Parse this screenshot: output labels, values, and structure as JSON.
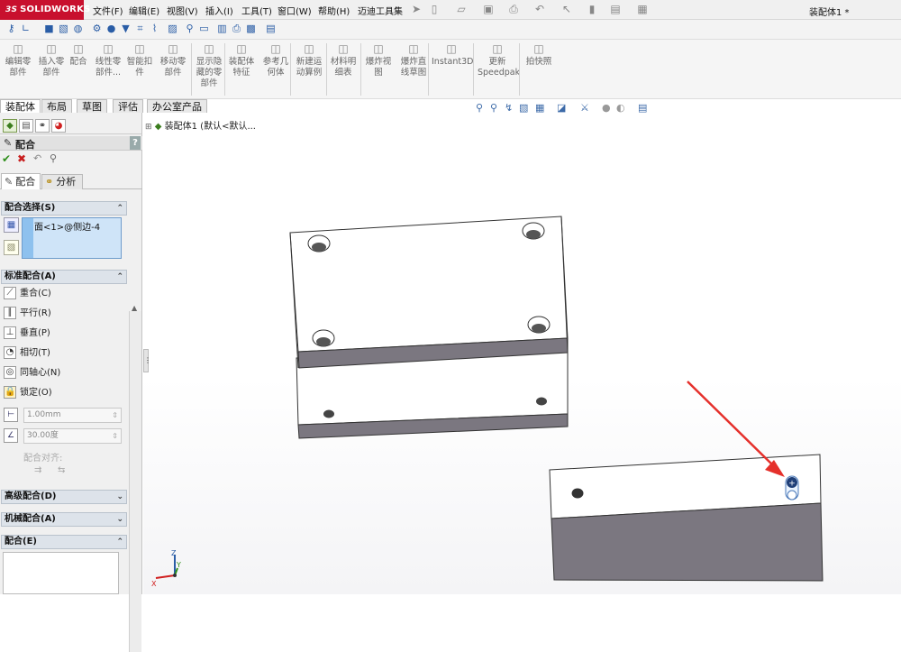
{
  "app": {
    "brand_ds": "3S",
    "brand_name": "SOLIDWORKS",
    "document_title": "装配体1 *"
  },
  "menu": [
    "文件(F)",
    "编辑(E)",
    "视图(V)",
    "插入(I)",
    "工具(T)",
    "窗口(W)",
    "帮助(H)",
    "迈迪工具集"
  ],
  "command_manager": [
    {
      "label": "编辑零\n部件",
      "icon": "edit-component-icon"
    },
    {
      "label": "插入零\n部件",
      "icon": "insert-component-icon"
    },
    {
      "label": "配合",
      "icon": "mate-icon"
    },
    {
      "label": "线性零\n部件...",
      "icon": "linear-pattern-icon"
    },
    {
      "label": "智能扣\n件",
      "icon": "smart-fastener-icon"
    },
    {
      "label": "移动零\n部件",
      "icon": "move-component-icon"
    },
    {
      "label": "显示隐\n藏的零\n部件",
      "icon": "show-hidden-icon"
    },
    {
      "label": "装配体\n特征",
      "icon": "assembly-feature-icon"
    },
    {
      "label": "参考几\n何体",
      "icon": "reference-geometry-icon"
    },
    {
      "label": "新建运\n动算例",
      "icon": "motion-study-icon"
    },
    {
      "label": "材料明\n细表",
      "icon": "bom-icon"
    },
    {
      "label": "爆炸视\n图",
      "icon": "exploded-view-icon"
    },
    {
      "label": "爆炸直\n线草图",
      "icon": "explode-line-icon"
    },
    {
      "label": "Instant3D",
      "icon": "instant3d-icon"
    },
    {
      "label": "更新\nSpeedpak",
      "icon": "speedpak-icon"
    },
    {
      "label": "拍快照",
      "icon": "snapshot-icon"
    }
  ],
  "tabs": [
    "装配体",
    "布局",
    "草图",
    "评估",
    "办公室产品"
  ],
  "property_manager": {
    "title": "配合",
    "help": "?",
    "subtabs": [
      "配合",
      "分析"
    ],
    "mate_selection": {
      "header": "配合选择(S)",
      "items": [
        "面<1>@侧边-4"
      ]
    },
    "standard_mates": {
      "header": "标准配合(A)",
      "options": [
        {
          "label": "重合(C)",
          "icon": "coincident-icon"
        },
        {
          "label": "平行(R)",
          "icon": "parallel-icon"
        },
        {
          "label": "垂直(P)",
          "icon": "perpendicular-icon"
        },
        {
          "label": "相切(T)",
          "icon": "tangent-icon"
        },
        {
          "label": "同轴心(N)",
          "icon": "concentric-icon"
        },
        {
          "label": "锁定(O)",
          "icon": "lock-icon"
        }
      ],
      "distance": "1.00mm",
      "angle": "30.00度",
      "alignment_label": "配合对齐:"
    },
    "advanced": "高级配合(D)",
    "mechanical": "机械配合(A)",
    "mates": "配合(E)"
  },
  "tree": {
    "root": "装配体1 (默认<默认..."
  },
  "triad": {
    "x": "X",
    "y": "Y",
    "z": "Z"
  },
  "colors": {
    "brand": "#c8102e",
    "accent": "#2a5da6",
    "part_face": "#ffffff",
    "part_side": "#7b7780",
    "arrow": "#e5302b"
  }
}
